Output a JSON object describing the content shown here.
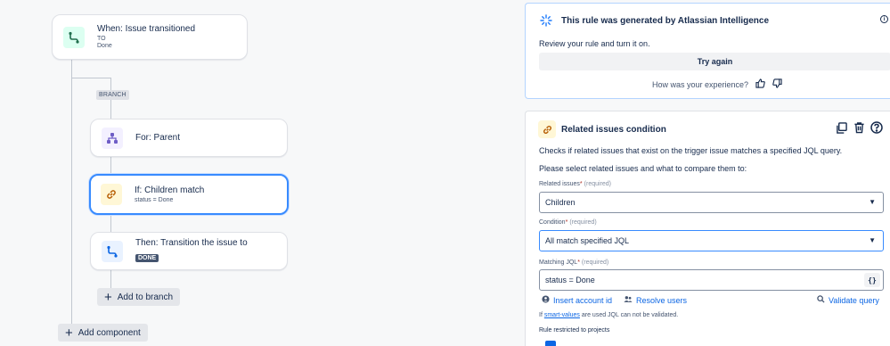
{
  "canvas": {
    "trigger": {
      "title": "When: Issue transitioned",
      "line1": "TO",
      "line2": "Done"
    },
    "branch_tag": "BRANCH",
    "branch_node": {
      "title": "For: Parent"
    },
    "condition_node": {
      "title": "If: Children match",
      "sub": "status = Done"
    },
    "action_node": {
      "title": "Then: Transition the issue to",
      "badge": "DONE"
    },
    "add_to_branch": "Add to branch",
    "add_component": "Add component"
  },
  "ai_panel": {
    "title": "This rule was generated by Atlassian Intelligence",
    "description": "Review your rule and turn it on.",
    "try_again": "Try again",
    "experience": "How was your experience?",
    "info_icon": "i"
  },
  "condition_panel": {
    "title": "Related issues condition",
    "description": "Checks if related issues that exist on the trigger issue matches a specified JQL query.",
    "instruction": "Please select related issues and what to compare them to:",
    "related_label": "Related issues",
    "related_value": "Children",
    "condition_label": "Condition",
    "condition_value": "All match specified JQL",
    "jql_label": "Matching JQL",
    "jql_value": "status = Done",
    "jql_button": "{}",
    "required_marker": "*",
    "required_text": "(required)",
    "insert_account": "Insert account id",
    "resolve_users": "Resolve users",
    "validate_query": "Validate query",
    "hint_prefix": "If",
    "hint_link": "smart-values",
    "hint_suffix": "are used JQL can not be validated.",
    "restricted": "Rule restricted to projects"
  },
  "colors": {
    "accent": "#0c66e4",
    "selected_border": "#388bff",
    "canvas_bg": "#f7f8f9"
  },
  "icons": {
    "trigger": "transition-icon",
    "branch": "hierarchy-icon",
    "condition": "link-icon",
    "action": "transition-icon",
    "ai": "sparkle-icon",
    "copy": "copy-icon",
    "delete": "trash-icon",
    "help": "question-icon"
  }
}
